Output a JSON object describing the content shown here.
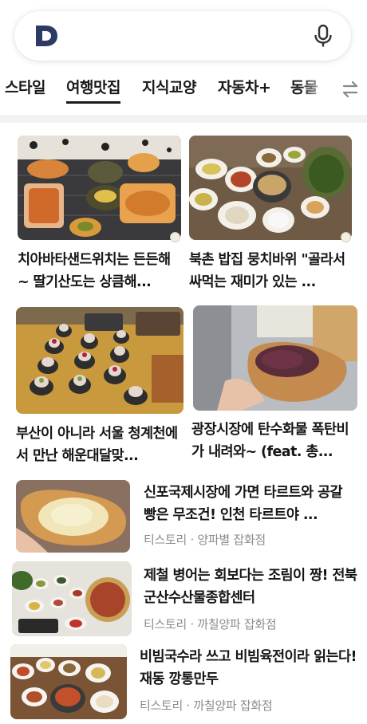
{
  "tabs": [
    {
      "label": "스타일"
    },
    {
      "label": "여행맛집"
    },
    {
      "label": "지식교양"
    },
    {
      "label": "자동차+"
    },
    {
      "label": "동물"
    }
  ],
  "grid": [
    {
      "title": "치아바타샌드위치는 든든해~ 딸기산도는 상큼해..."
    },
    {
      "title": "북촌 밥집 뭉치바위 \"골라서 싸먹는 재미가 있는 ..."
    },
    {
      "title": "부산이 아니라 서울 청계천에서 만난 해운대달맞..."
    },
    {
      "title": "광장시장에 탄수화물 폭탄비가 내려와~ (feat. 총..."
    }
  ],
  "list": [
    {
      "title": "신포국제시장에 가면 타르트와 공갈빵은 무조건! 인천 타르트야 ...",
      "source": "티스토리 · 양파별 잡화점"
    },
    {
      "title": "제철 병어는 회보다는 조림이 짱! 전북 군산수산물종합센터",
      "source": "티스토리 · 까칠양파 잡화점"
    },
    {
      "title": "비빔국수라 쓰고 비빔육전이라 읽는다! 재동 깡통만두",
      "source": "티스토리 · 까칠양파 잡화점"
    }
  ],
  "icons": {
    "logo": "daum-d-logo",
    "mic": "microphone-icon",
    "more": "swap-arrows-icon"
  },
  "colors": {
    "logo": "#2d3a63",
    "tab_text": "#1a1a1a",
    "meta": "#8b8b8b",
    "separator": "#f2f2f4"
  }
}
